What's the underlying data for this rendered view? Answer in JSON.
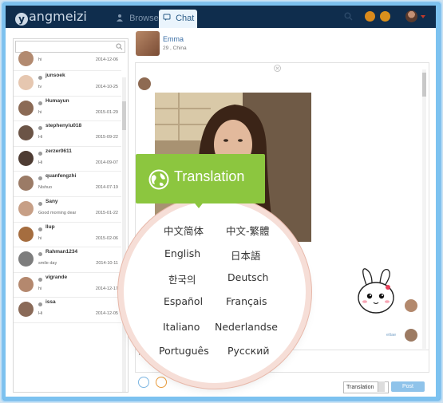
{
  "app": {
    "logo_letter": "y",
    "logo_text": "angmeizi"
  },
  "tabs": [
    {
      "label": "Browse"
    },
    {
      "label": "Chat"
    }
  ],
  "contacts": [
    {
      "name": "",
      "message": "hi",
      "date": "2014-12-06"
    },
    {
      "name": "junsoek",
      "message": "tv",
      "date": "2014-10-25"
    },
    {
      "name": "Humayun",
      "message": "hi",
      "date": "2015-01-29"
    },
    {
      "name": "stephenyiu018",
      "message": "Hi",
      "date": "2015-09-22"
    },
    {
      "name": "zerzer0611",
      "message": "Hi",
      "date": "2014-09-07"
    },
    {
      "name": "quanfengzhi",
      "message": "Nishuo",
      "date": "2014-07-19"
    },
    {
      "name": "Sany",
      "message": "Good morning dear",
      "date": "2015-01-22"
    },
    {
      "name": "llup",
      "message": "hi",
      "date": "2015-02-06"
    },
    {
      "name": "Rahman1234",
      "message": "smile day",
      "date": "2014-10-11"
    },
    {
      "name": "vigrande",
      "message": "hi",
      "date": "2014-12-17"
    },
    {
      "name": "issa",
      "message": "Hi",
      "date": "2014-12-05"
    }
  ],
  "contact": {
    "name": "Emma",
    "info": "29 , China"
  },
  "translation": {
    "title": "Translation",
    "languages": [
      "中文简体",
      "中文-繁體",
      "English",
      "日本語",
      "한국의",
      "Deutsch",
      "Español",
      "Français",
      "Italiano",
      "Nederlandse",
      "Português",
      "Русский"
    ]
  },
  "composer": {
    "select_value": "Translation",
    "post_label": "Post",
    "reply_hint": "hi",
    "tail_text": "ettae"
  },
  "colors": {
    "topbar": "#0f2d4d",
    "accent": "#8cc63f",
    "post": "#8fc3ea"
  },
  "icons": [
    "search-icon",
    "browse-icon",
    "chat-icon",
    "globe-icon",
    "close-icon",
    "smile-icon"
  ]
}
